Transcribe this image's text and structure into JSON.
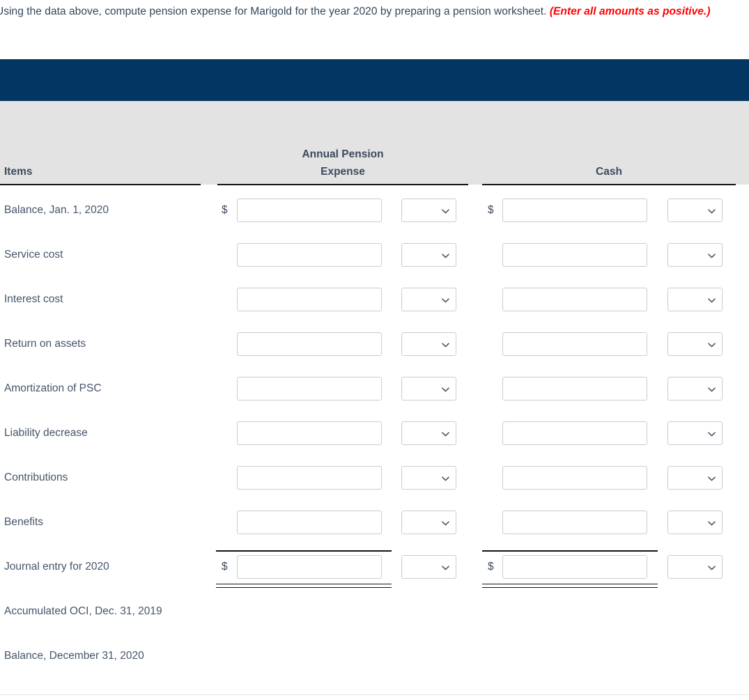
{
  "prompt": {
    "text_before": "Using the data above, compute pension expense for Marigold for the year 2020 by preparing a pension worksheet. ",
    "emphasis": "(Enter all amounts as positive.)"
  },
  "worksheet": {
    "columns": {
      "items": "Items",
      "annual_pension_expense_line1": "Annual Pension",
      "annual_pension_expense_line2": "Expense",
      "cash": "Cash"
    },
    "currency_symbol": "$",
    "dropdown_icon": "chevron-down-icon",
    "input_value": "",
    "input_placeholder": "",
    "rows": [
      {
        "label": "Balance, Jan. 1, 2020",
        "has_inputs": true,
        "show_dollar": true,
        "rule": "none"
      },
      {
        "label": "Service cost",
        "has_inputs": true,
        "show_dollar": false,
        "rule": "none"
      },
      {
        "label": "Interest cost",
        "has_inputs": true,
        "show_dollar": false,
        "rule": "none"
      },
      {
        "label": "Return on assets",
        "has_inputs": true,
        "show_dollar": false,
        "rule": "none"
      },
      {
        "label": "Amortization of PSC",
        "has_inputs": true,
        "show_dollar": false,
        "rule": "none"
      },
      {
        "label": "Liability decrease",
        "has_inputs": true,
        "show_dollar": false,
        "rule": "none"
      },
      {
        "label": "Contributions",
        "has_inputs": true,
        "show_dollar": false,
        "rule": "none"
      },
      {
        "label": "Benefits",
        "has_inputs": true,
        "show_dollar": false,
        "rule": "none"
      },
      {
        "label": "Journal entry for 2020",
        "has_inputs": true,
        "show_dollar": true,
        "rule": "total"
      },
      {
        "label": "Accumulated OCI, Dec. 31, 2019",
        "has_inputs": false,
        "show_dollar": false,
        "rule": "none"
      },
      {
        "label": "Balance, December 31, 2020",
        "has_inputs": false,
        "show_dollar": false,
        "rule": "none"
      }
    ]
  },
  "colors": {
    "header_bar": "#033663",
    "header_band": "#e3e3e3",
    "emphasis": "#ff0000",
    "text": "#3b4a5a"
  }
}
